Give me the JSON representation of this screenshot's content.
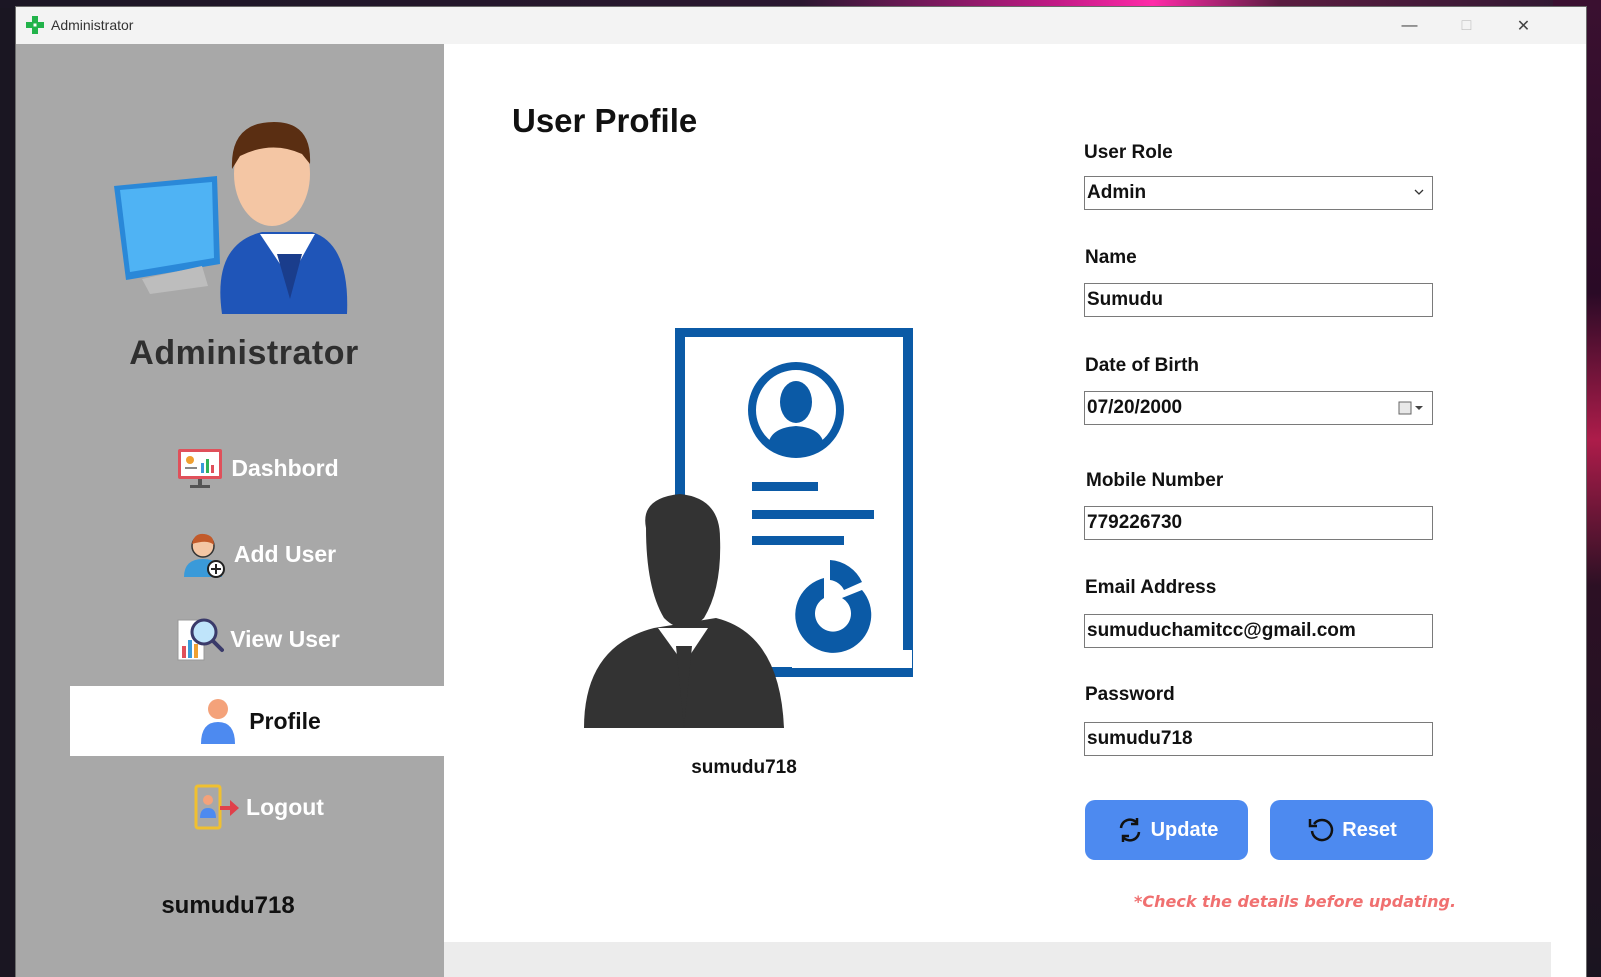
{
  "window": {
    "title": "Administrator"
  },
  "sidebar": {
    "title": "Administrator",
    "username": "sumudu718",
    "items": [
      {
        "label": "Dashbord",
        "icon": "dashboard-icon",
        "active": false
      },
      {
        "label": "Add User",
        "icon": "add-user-icon",
        "active": false
      },
      {
        "label": "View User",
        "icon": "view-user-icon",
        "active": false
      },
      {
        "label": "Profile",
        "icon": "profile-icon",
        "active": true
      },
      {
        "label": "Logout",
        "icon": "logout-icon",
        "active": false
      }
    ]
  },
  "main": {
    "title": "User Profile",
    "profile_username": "sumudu718"
  },
  "form": {
    "user_role": {
      "label": "User Role",
      "value": "Admin"
    },
    "name": {
      "label": "Name",
      "value": "Sumudu"
    },
    "dob": {
      "label": "Date of Birth",
      "value": "07/20/2000"
    },
    "mobile": {
      "label": "Mobile Number",
      "value": "779226730"
    },
    "email": {
      "label": "Email Address",
      "value": "sumuduchamitcc@gmail.com"
    },
    "password": {
      "label": "Password",
      "value": "sumudu718"
    }
  },
  "buttons": {
    "update": "Update",
    "reset": "Reset"
  },
  "note": "*Check the details before updating.",
  "colors": {
    "sidebar": "#a8a8a8",
    "accent": "#4d8af0",
    "illustration_blue": "#0b5aa6",
    "warning": "#f07070"
  }
}
